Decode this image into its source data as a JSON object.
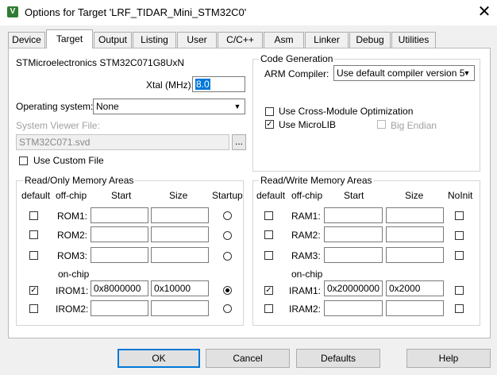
{
  "window": {
    "title": "Options for Target 'LRF_TIDAR_Mini_STM32C0'",
    "icon": "keil-uvision-icon"
  },
  "tabs": [
    "Device",
    "Target",
    "Output",
    "Listing",
    "User",
    "C/C++",
    "Asm",
    "Linker",
    "Debug",
    "Utilities"
  ],
  "active_tab": "Target",
  "device_name": "STMicroelectronics STM32C071G8UxN",
  "xtal": {
    "label": "Xtal (MHz):",
    "value": "8.0"
  },
  "os": {
    "label": "Operating system:",
    "value": "None"
  },
  "svd": {
    "label": "System Viewer File:",
    "value": "STM32C071.svd",
    "browse": "...",
    "custom_label": "Use Custom File"
  },
  "codegen": {
    "title": "Code Generation",
    "compiler_label": "ARM Compiler:",
    "compiler_value": "Use default compiler version 5",
    "cross_module": "Use Cross-Module Optimization",
    "microlib": "Use MicroLIB",
    "big_endian": "Big Endian"
  },
  "ro_memory": {
    "title": "Read/Only Memory Areas",
    "headers": {
      "default": "default",
      "offchip": "off-chip",
      "start": "Start",
      "size": "Size",
      "startup": "Startup"
    },
    "onchip_label": "on-chip",
    "rows": [
      {
        "name": "ROM1:",
        "start": "",
        "size": "",
        "default": false,
        "startup": false
      },
      {
        "name": "ROM2:",
        "start": "",
        "size": "",
        "default": false,
        "startup": false
      },
      {
        "name": "ROM3:",
        "start": "",
        "size": "",
        "default": false,
        "startup": false
      },
      {
        "name": "IROM1:",
        "start": "0x8000000",
        "size": "0x10000",
        "default": true,
        "startup": true
      },
      {
        "name": "IROM2:",
        "start": "",
        "size": "",
        "default": false,
        "startup": false
      }
    ]
  },
  "rw_memory": {
    "title": "Read/Write Memory Areas",
    "headers": {
      "default": "default",
      "offchip": "off-chip",
      "start": "Start",
      "size": "Size",
      "noinit": "NoInit"
    },
    "onchip_label": "on-chip",
    "rows": [
      {
        "name": "RAM1:",
        "start": "",
        "size": "",
        "default": false,
        "noinit": false
      },
      {
        "name": "RAM2:",
        "start": "",
        "size": "",
        "default": false,
        "noinit": false
      },
      {
        "name": "RAM3:",
        "start": "",
        "size": "",
        "default": false,
        "noinit": false
      },
      {
        "name": "IRAM1:",
        "start": "0x20000000",
        "size": "0x2000",
        "default": true,
        "noinit": false
      },
      {
        "name": "IRAM2:",
        "start": "",
        "size": "",
        "default": false,
        "noinit": false
      }
    ]
  },
  "buttons": {
    "ok": "OK",
    "cancel": "Cancel",
    "defaults": "Defaults",
    "help": "Help"
  }
}
